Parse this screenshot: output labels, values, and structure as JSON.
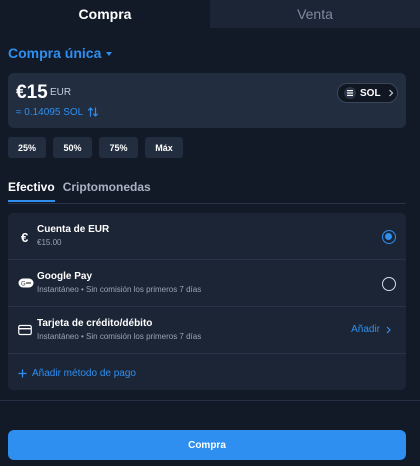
{
  "top_tabs": [
    {
      "label": "Compra",
      "active": true
    },
    {
      "label": "Venta",
      "active": false
    }
  ],
  "mode": {
    "label": "Compra única"
  },
  "amount": {
    "value": "€15",
    "currency": "EUR",
    "conversion": "≈ 0.14095 SOL",
    "asset": "SOL"
  },
  "percent_buttons": [
    "25%",
    "50%",
    "75%",
    "Máx"
  ],
  "payment_tabs": [
    {
      "label": "Efectivo",
      "active": true
    },
    {
      "label": "Criptomonedas",
      "active": false
    }
  ],
  "methods": [
    {
      "title": "Cuenta de EUR",
      "subtitle": "€15.00",
      "icon": "euro-icon",
      "selected": true
    },
    {
      "title": "Google Pay",
      "subtitle": "Instantáneo • Sin comisión los primeros 7 días",
      "icon": "google-pay-icon",
      "selected": false
    },
    {
      "title": "Tarjeta de crédito/débito",
      "subtitle": "Instantáneo • Sin comisión los primeros 7 días",
      "icon": "credit-card-icon",
      "action": "Añadir"
    }
  ],
  "add_method_label": "Añadir método de pago",
  "submit_label": "Compra",
  "colors": {
    "accent": "#2e8ff0",
    "background": "#121a28",
    "card": "#222d40"
  }
}
